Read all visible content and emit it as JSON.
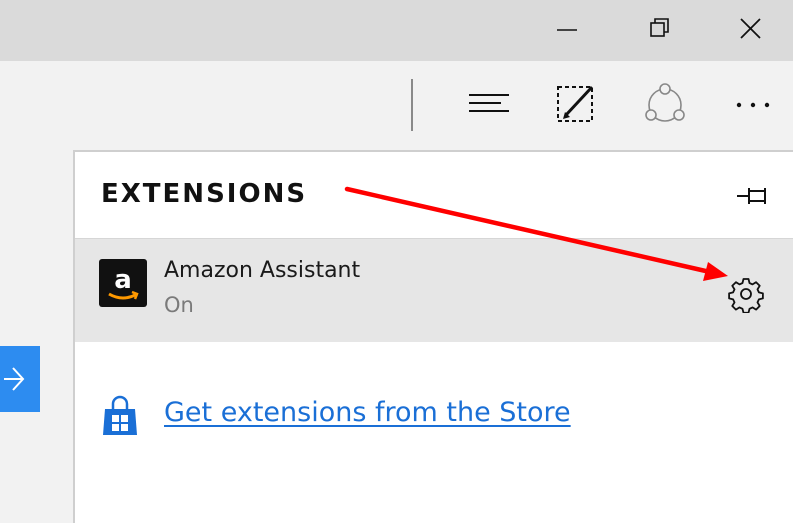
{
  "window_controls": {
    "minimize": "minimize",
    "restore": "restore",
    "close": "close"
  },
  "toolbar": {
    "icons": [
      "hub-icon",
      "web-note-icon",
      "share-icon",
      "more-icon"
    ]
  },
  "extensions_panel": {
    "title": "EXTENSIONS",
    "items": [
      {
        "name": "Amazon Assistant",
        "status": "On",
        "logo_letter": "a"
      }
    ],
    "store_link": "Get extensions from the Store"
  },
  "colors": {
    "accent": "#2d8cf0",
    "link": "#1a6fd6",
    "annotation_arrow": "#ff0000",
    "selected_item_bg": "#e6e6e6"
  }
}
